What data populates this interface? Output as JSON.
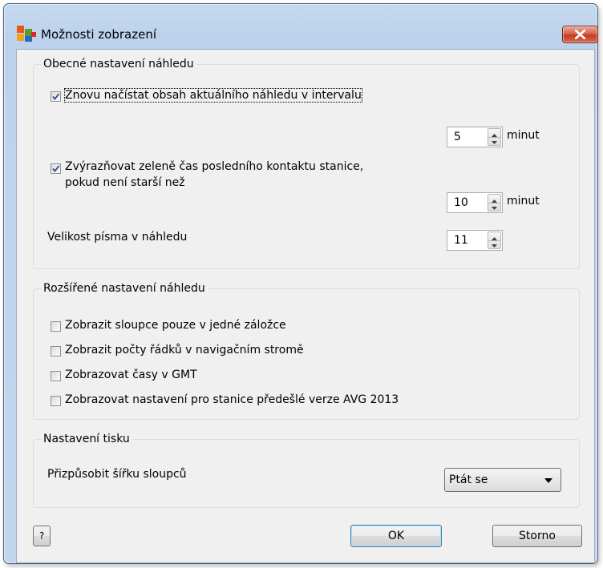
{
  "window": {
    "title": "Možnosti zobrazení",
    "close_icon": "close-icon"
  },
  "general": {
    "legend": "Obecné nastavení náhledu",
    "reload": {
      "label": "Znovu načístat obsah aktuálního náhledu v intervalu",
      "checked": true,
      "value": "5",
      "unit": "minut"
    },
    "highlight": {
      "label_line1": "Zvýrazňovat zeleně čas posledního kontaktu stanice,",
      "label_line2": "pokud není starší než",
      "checked": true,
      "value": "10",
      "unit": "minut"
    },
    "font_size": {
      "label": "Velikost písma v náhledu",
      "value": "11"
    }
  },
  "advanced": {
    "legend": "Rozšířené nastavení náhledu",
    "options": [
      {
        "label": "Zobrazit sloupce pouze v jedné záložce",
        "checked": false
      },
      {
        "label": "Zobrazit počty řádků v navigačním stromě",
        "checked": false
      },
      {
        "label": "Zobrazovat časy v GMT",
        "checked": false
      },
      {
        "label": "Zobrazovat nastavení pro stanice předešlé verze AVG 2013",
        "checked": false
      }
    ]
  },
  "print": {
    "legend": "Nastavení tisku",
    "fit_label": "Přizpůsobit šířku sloupců",
    "fit_value": "Ptát se"
  },
  "buttons": {
    "help": "?",
    "ok": "OK",
    "cancel": "Storno"
  },
  "colors": {
    "titlebar": "#c6d9ef",
    "close_button": "#c43c20",
    "dialog_bg": "#f0f0f0",
    "check_mark": "#2a4a8c"
  }
}
